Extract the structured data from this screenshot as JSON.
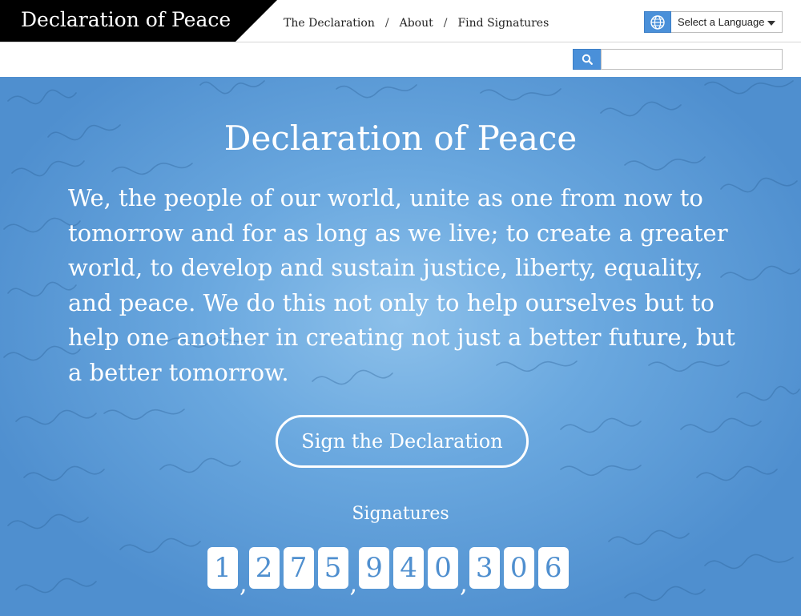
{
  "brand": {
    "title": "Declaration of Peace",
    "color": "#000000"
  },
  "nav": {
    "items": [
      "The Declaration",
      "About",
      "Find Signatures"
    ],
    "separator": "/"
  },
  "language": {
    "selected": "Select a Language",
    "icon": "globe-icon"
  },
  "search": {
    "icon": "search-icon",
    "value": ""
  },
  "hero": {
    "title": "Declaration of Peace",
    "body": "We, the people of our world, unite as one from now to tomorrow and for as long as we live; to create a greater world, to develop and sustain justice, liberty, equality, and peace. We do this not only to help ourselves but to help one another in creating not just a better future, but a better tomorrow.",
    "cta": "Sign the Declaration",
    "signatures_label": "Signatures",
    "signature_count_groups": [
      "1",
      "275",
      "940",
      "306"
    ],
    "background": "signatures-pattern",
    "accent": "#4f8fcf"
  }
}
